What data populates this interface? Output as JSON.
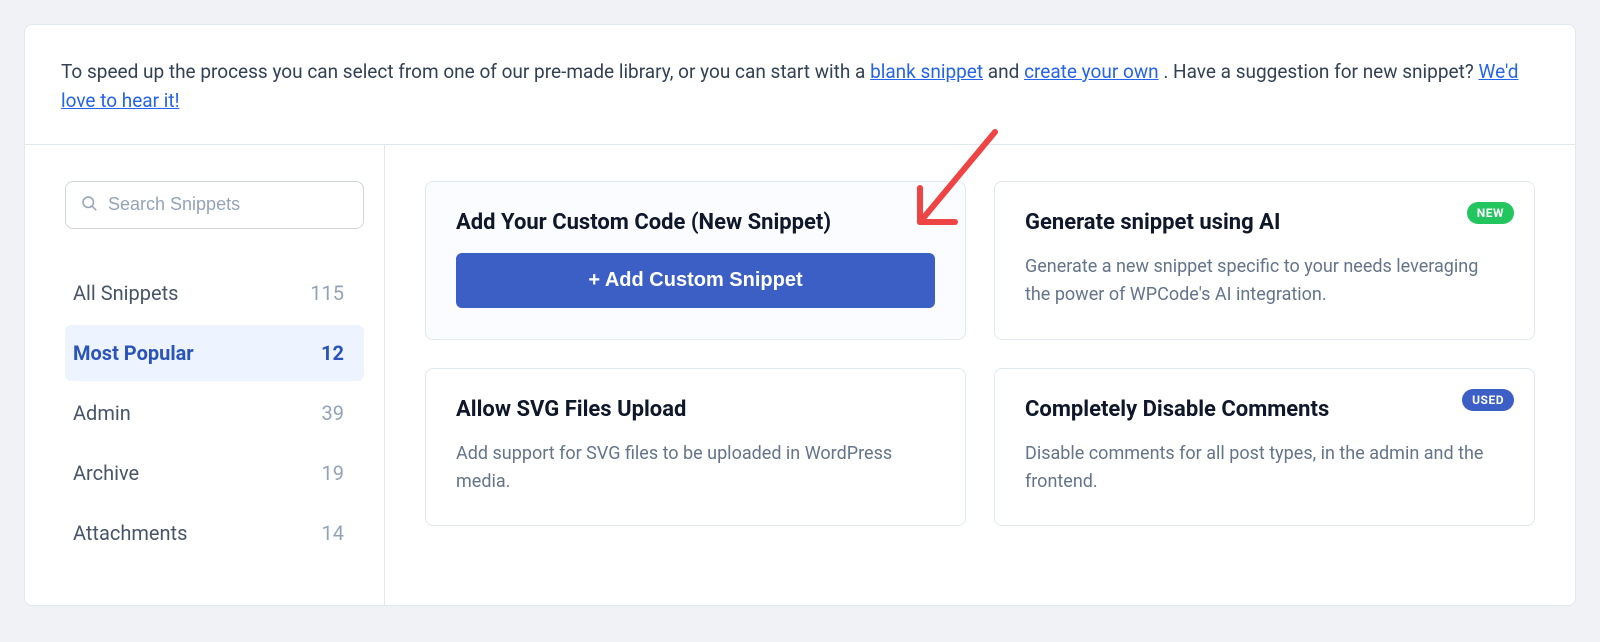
{
  "intro": {
    "pre": "To speed up the process you can select from one of our pre-made library, or you can start with a ",
    "link1": "blank snippet",
    "mid1": " and ",
    "link2": "create your own",
    "mid2": ". Have a suggestion for new snippet? ",
    "link3": "We'd love to hear it!"
  },
  "sidebar": {
    "search_placeholder": "Search Snippets",
    "items": [
      {
        "label": "All Snippets",
        "count": "115"
      },
      {
        "label": "Most Popular",
        "count": "12"
      },
      {
        "label": "Admin",
        "count": "39"
      },
      {
        "label": "Archive",
        "count": "19"
      },
      {
        "label": "Attachments",
        "count": "14"
      }
    ],
    "active_index": 1
  },
  "tiles": {
    "custom_code": {
      "title": "Add Your Custom Code (New Snippet)",
      "button": "+ Add Custom Snippet"
    },
    "ai": {
      "title": "Generate snippet using AI",
      "desc": "Generate a new snippet specific to your needs leveraging the power of WPCode's AI integration.",
      "badge": "NEW"
    },
    "svg": {
      "title": "Allow SVG Files Upload",
      "desc": "Add support for SVG files to be uploaded in WordPress media."
    },
    "comments": {
      "title": "Completely Disable Comments",
      "desc": "Disable comments for all post types, in the admin and the frontend.",
      "badge": "USED"
    }
  }
}
